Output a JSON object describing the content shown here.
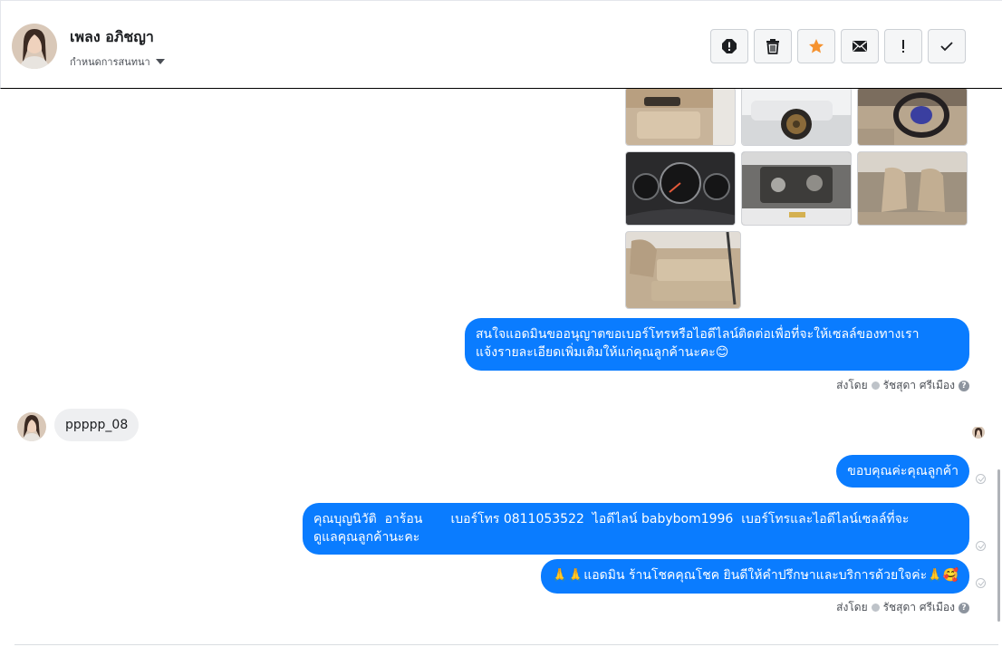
{
  "header": {
    "contact_name": "เพลง อภิชญา",
    "assign_label": "กำหนดการสนทนา",
    "actions": [
      {
        "icon": "spam-alert-icon"
      },
      {
        "icon": "trash-icon"
      },
      {
        "icon": "star-icon",
        "color": "#f5922f"
      },
      {
        "icon": "envelope-icon"
      },
      {
        "icon": "exclamation-icon"
      },
      {
        "icon": "checkmark-icon"
      }
    ]
  },
  "messages": {
    "photos": [
      {
        "icon": "car-door-panel-photo"
      },
      {
        "icon": "car-wheel-photo"
      },
      {
        "icon": "steering-wheel-photo"
      },
      {
        "icon": "dashboard-gauges-photo"
      },
      {
        "icon": "engine-bay-photo"
      },
      {
        "icon": "front-seats-photo"
      },
      {
        "icon": "rear-seat-photo"
      }
    ],
    "out1_line1": "สนใจแอดมินขออนุญาตขอเบอร์โทรหรือไอดีไลน์ติดต่อเพื่อที่จะให้เซลล์ของทางเรา",
    "out1_line2": "แจ้งรายละเอียดเพิ่มเติมให้แก่คุณลูกค้านะคะ😊",
    "sent_by_1": "ส่งโดย",
    "agent_1": "รัชสุดา ศรีเมือง",
    "incoming": "ppppp_08",
    "out2": "ขอบคุณค่ะคุณลูกค้า",
    "out3_line1": "คุณบุญนิวัติ  อาร้อน       เบอร์โทร 0811053522  ไอดีไลน์ babybom1996  เบอร์โทรและไอดีไลน์เซลล์ที่จะ",
    "out3_line2": "ดูแลคุณลูกค้านะคะ",
    "out4": "🙏🙏แอดมิน ร้านโชคคุณโชค ยินดีให้คำปรึกษาและบริการด้วยใจค่ะ🙏🥰",
    "sent_by_2": "ส่งโดย",
    "agent_2": "รัชสุดา ศรีเมือง"
  },
  "colors": {
    "bubble_out": "#0a7cff",
    "bubble_in": "#eeeff1",
    "star": "#f5922f"
  }
}
